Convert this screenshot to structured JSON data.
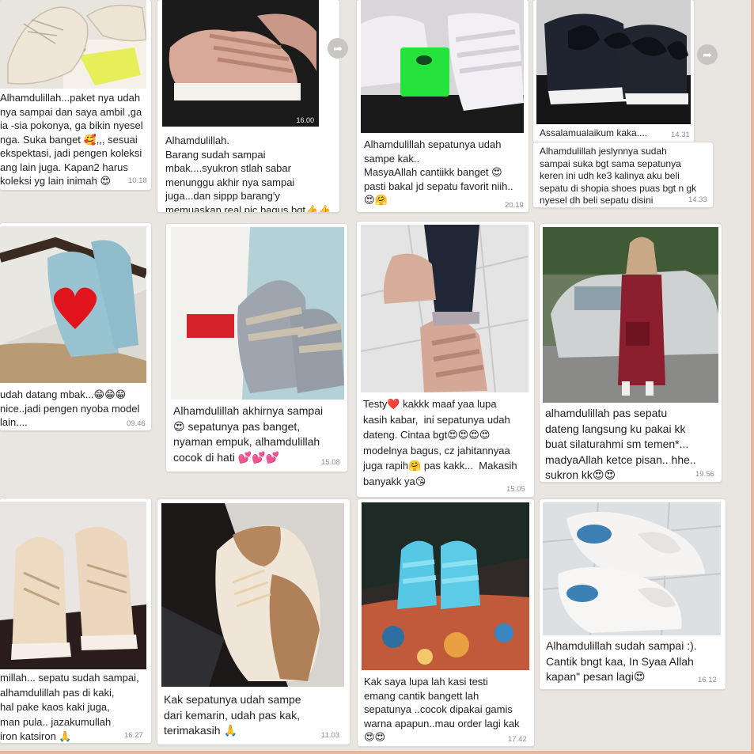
{
  "colors": {
    "background": "#e9e6e2",
    "bubble": "#ffffff",
    "timestamp": "#8d8d8d",
    "frame": "#e8b79a"
  },
  "testimonials": [
    {
      "caption": "Alhamdulillah...paket nya udah\nnya sampai dan saya ambil ,ga\nia -sia pokonya, ga bikin nyesel\nnga. Suka banget 🥰,,, sesuai\nekspektasi, jadi pengen koleksi\nang lain juga. Kapan2 harus\nkoleksi yg lain inimah 😍",
      "time": "10.18",
      "image_icon": "cream-sneaker-photo"
    },
    {
      "caption": "Alhamdulillah.\nBarang sudah sampai\nmbak....syukron stlah sabar\nmenunggu akhir nya sampai\njuga...dan sippp barang'y\nmemuaskan real pic bagus bgt👍👍",
      "time": "16.00",
      "image_icon": "pink-platform-shoe-photo"
    },
    {
      "caption": "Alhamdulillah sepatunya udah\nsampe kak..\nMasyaAllah cantiikk banget 😍\npasti bakal jd sepatu favorit niih..\n😍🤗",
      "time": "20.19",
      "image_icon": "white-velcro-shoe-photo"
    },
    {
      "caption": "Assalamualaikum kaka....",
      "time": "14.31",
      "image_icon": "black-bow-shoe-photo"
    },
    {
      "caption": "Alhamdulillah jeslynnya sudah\nsampai suka bgt sama sepatunya\nkeren ini udh ke3 kalinya aku beli\nsepatu di shopia shoes puas bgt n gk\nnyesel dh beli sepatu disini",
      "time": "14.33"
    },
    {
      "caption": "udah datang mbak...😁😁😁\nnice..jadi pengen nyoba model\nlain....",
      "time": "09.46",
      "image_icon": "blue-shoe-with-heart-photo"
    },
    {
      "caption": "Alhamdulillah akhirnya sampai\n😍 sepatunya pas banget,\nnyaman empuk, alhamdulillah\ncocok di hati 💕💕💕",
      "time": "15.08",
      "image_icon": "grey-velcro-shoe-photo"
    },
    {
      "caption": "Testy❤️ kakkk maaf yaa lupa\nkasih kabar,  ini sepatunya udah\ndateng. Cintaa bgt😍😍😍😍\nmodelnya bagus, cz jahitannyaa\njuga rapih🤗 pas kakk...  Makasih\nbanyakk ya😘",
      "time": "15.05",
      "image_icon": "nude-velcro-shoe-worn-photo"
    },
    {
      "caption": "alhamdulillah pas sepatu\ndateng langsung ku pakai kk\nbuat silaturahmi sm temen*...\nmadyaAllah ketce pisan.. hhe..\nsukron kk😍😍",
      "time": "19.56",
      "image_icon": "woman-with-car-photo"
    },
    {
      "caption": "millah... sepatu sudah sampai,\nalhamdulillah pas di kaki,\nhal pake kaos kaki juga,\nman pula.. jazakumullah\niron katsiron 🙏",
      "time": "16.27",
      "image_icon": "beige-lace-shoe-photo"
    },
    {
      "caption": "Kak sepatunya udah sampe\ndari kemarin, udah pas kak,\nterimakasih 🙏",
      "time": "11.03",
      "image_icon": "brown-oxford-shoe-photo"
    },
    {
      "caption": "Kak saya lupa lah kasi testi\nemang cantik bangett lah\nsepatunya ..cocok dipakai gamis\nwarna apapun..mau order lagi kak\n😍😍",
      "time": "17.42",
      "image_icon": "light-blue-shoe-photo"
    },
    {
      "caption": "Alhamdulillah sudah sampai :).\nCantik bngt kaa, In Syaa Allah\nkapan\" pesan lagi😍",
      "time": "16.12",
      "image_icon": "white-knot-slipon-photo"
    }
  ],
  "icons": {
    "share": "share-arrow-icon"
  }
}
